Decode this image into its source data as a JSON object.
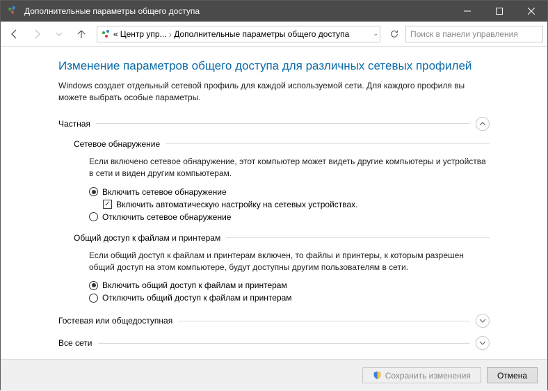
{
  "window": {
    "title": "Дополнительные параметры общего доступа"
  },
  "breadcrumb": {
    "prefix": "«",
    "item1": "Центр упр...",
    "item2": "Дополнительные параметры общего доступа"
  },
  "search": {
    "placeholder": "Поиск в панели управления"
  },
  "heading": "Изменение параметров общего доступа для различных сетевых профилей",
  "subtext": "Windows создает отдельный сетевой профиль для каждой используемой сети. Для каждого профиля вы можете выбрать особые параметры.",
  "profiles": {
    "private": {
      "label": "Частная"
    },
    "guest": {
      "label": "Гостевая или общедоступная"
    },
    "all": {
      "label": "Все сети"
    }
  },
  "network_discovery": {
    "title": "Сетевое обнаружение",
    "desc": "Если включено сетевое обнаружение, этот компьютер может видеть другие компьютеры и устройства в сети и виден другим компьютерам.",
    "opt_on": "Включить сетевое обнаружение",
    "opt_auto": "Включить автоматическую настройку на сетевых устройствах.",
    "opt_off": "Отключить сетевое обнаружение"
  },
  "file_sharing": {
    "title": "Общий доступ к файлам и принтерам",
    "desc": "Если общий доступ к файлам и принтерам включен, то файлы и принтеры, к которым разрешен общий доступ на этом компьютере, будут доступны другим пользователям в сети.",
    "opt_on": "Включить общий доступ к файлам и принтерам",
    "opt_off": "Отключить общий доступ к файлам и принтерам"
  },
  "footer": {
    "save": "Сохранить изменения",
    "cancel": "Отмена"
  }
}
